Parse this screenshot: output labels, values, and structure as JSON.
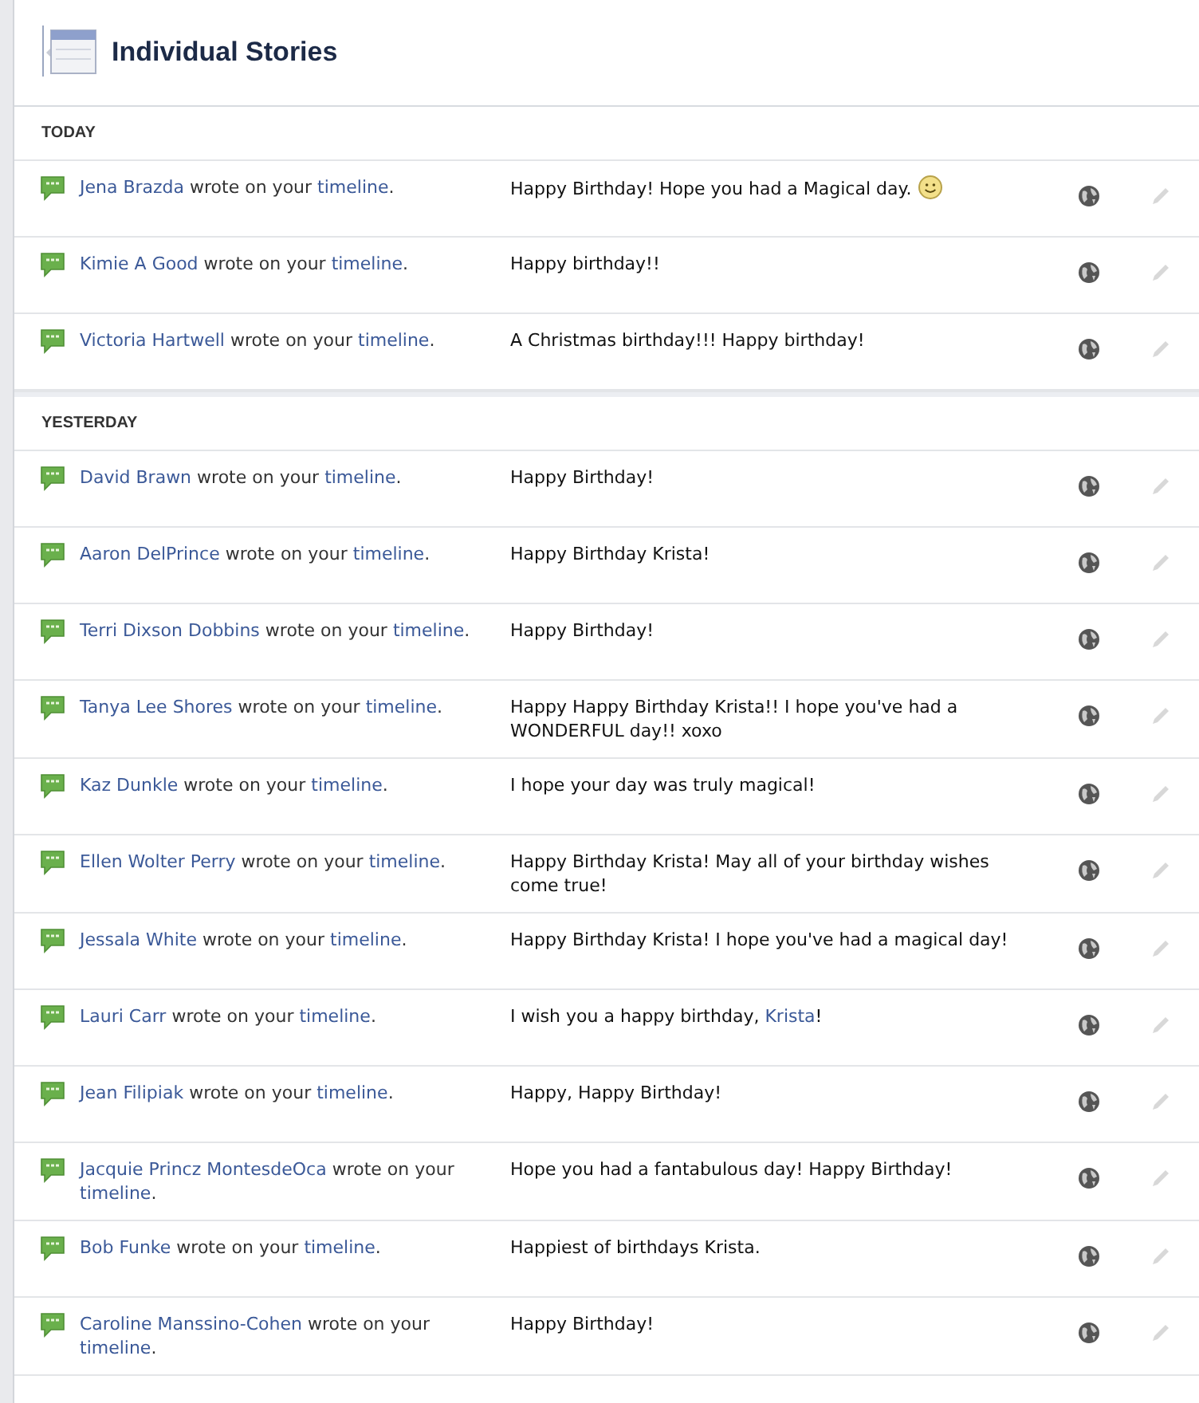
{
  "header": {
    "title": "Individual Stories"
  },
  "sections": [
    {
      "label": "TODAY",
      "rows": [
        {
          "author": "Jena Brazda",
          "verb": "wrote on your",
          "link": "timeline",
          "end": ".",
          "message": "Happy Birthday! Hope you had a Magical day.",
          "smiley": true
        },
        {
          "author": "Kimie A Good",
          "verb": "wrote on your",
          "link": "timeline",
          "end": ".",
          "message": "Happy birthday!!"
        },
        {
          "author": "Victoria Hartwell",
          "verb": "wrote on your",
          "link": "timeline",
          "end": ".",
          "message": "A Christmas birthday!!! Happy birthday!"
        }
      ]
    },
    {
      "label": "YESTERDAY",
      "rows": [
        {
          "author": "David Brawn",
          "verb": "wrote on your",
          "link": "timeline",
          "end": ".",
          "message": "Happy Birthday!"
        },
        {
          "author": "Aaron DelPrince",
          "verb": "wrote on your",
          "link": "timeline",
          "end": ".",
          "message": "Happy Birthday Krista!"
        },
        {
          "author": "Terri Dixson Dobbins",
          "verb": "wrote on your",
          "link": "timeline",
          "end": ".",
          "message": "Happy Birthday!"
        },
        {
          "author": "Tanya Lee Shores",
          "verb": "wrote on your",
          "link": "timeline",
          "end": ".",
          "message": "Happy Happy Birthday Krista!! I hope you've had a WONDERFUL day!! xoxo"
        },
        {
          "author": "Kaz Dunkle",
          "verb": "wrote on your",
          "link": "timeline",
          "end": ".",
          "message": "I hope your day was truly magical!"
        },
        {
          "author": "Ellen Wolter Perry",
          "verb": "wrote on your",
          "link": "timeline",
          "end": ".",
          "message": "Happy Birthday Krista! May all of your birthday wishes come true!"
        },
        {
          "author": "Jessala White",
          "verb": "wrote on your",
          "link": "timeline",
          "end": ".",
          "message": "Happy Birthday Krista! I hope you've had a magical day!"
        },
        {
          "author": "Lauri Carr",
          "verb": "wrote on your",
          "link": "timeline",
          "end": ".",
          "message": "I wish you a happy birthday, ",
          "message_link": "Krista",
          "message_end": "!"
        },
        {
          "author": "Jean Filipiak",
          "verb": "wrote on your",
          "link": "timeline",
          "end": ".",
          "message": "Happy, Happy Birthday!"
        },
        {
          "author": "Jacquie Princz MontesdeOca",
          "verb": "wrote on your",
          "link": "timeline",
          "end": ".",
          "message": "Hope you had a fantabulous day! Happy Birthday!"
        },
        {
          "author": "Bob Funke",
          "verb": "wrote on your",
          "link": "timeline",
          "end": ".",
          "message": "Happiest of birthdays Krista."
        },
        {
          "author": "Caroline Manssino-Cohen",
          "verb": "wrote on your",
          "link": "timeline",
          "end": ".",
          "message": "Happy Birthday!"
        }
      ]
    }
  ]
}
